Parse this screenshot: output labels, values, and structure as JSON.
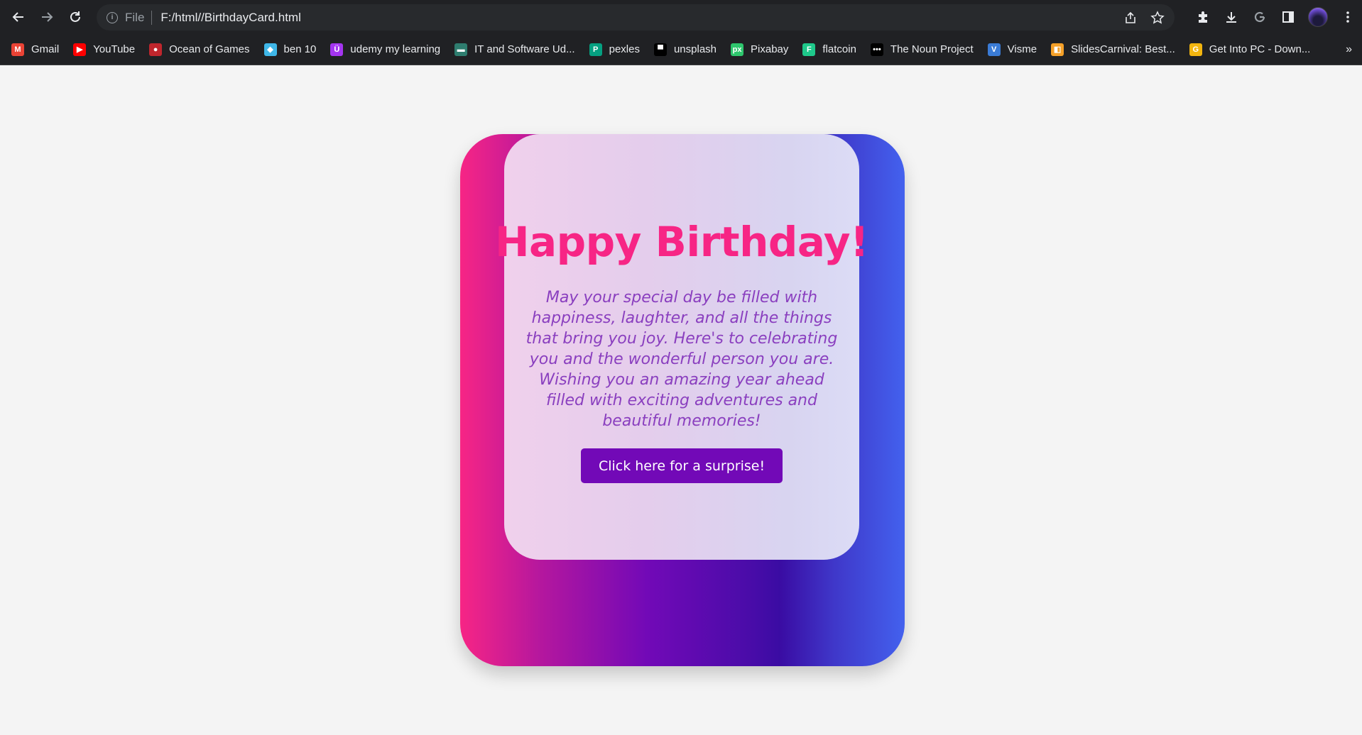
{
  "browser": {
    "file_label": "File",
    "url": "F:/html//BirthdayCard.html",
    "bookmarks": [
      {
        "label": "Gmail",
        "icon": "gmail-icon",
        "color": "#ea4335"
      },
      {
        "label": "YouTube",
        "icon": "youtube-icon",
        "color": "#ff0000"
      },
      {
        "label": "Ocean of Games",
        "icon": "gamepad-icon",
        "color": "#c0262d"
      },
      {
        "label": "ben 10",
        "icon": "ben10-icon",
        "color": "#3fb7e8"
      },
      {
        "label": "udemy my learning",
        "icon": "udemy-icon",
        "color": "#a435f0"
      },
      {
        "label": "IT and Software Ud...",
        "icon": "it-software-icon",
        "color": "#2e7d6f"
      },
      {
        "label": "pexles",
        "icon": "pexels-icon",
        "color": "#05a081"
      },
      {
        "label": "unsplash",
        "icon": "unsplash-icon",
        "color": "#000000"
      },
      {
        "label": "Pixabay",
        "icon": "pixabay-icon",
        "color": "#2ec66d"
      },
      {
        "label": "flatcoin",
        "icon": "flaticon-icon",
        "color": "#1ec88a"
      },
      {
        "label": "The Noun Project",
        "icon": "noun-project-icon",
        "color": "#000000"
      },
      {
        "label": "Visme",
        "icon": "visme-icon",
        "color": "#3a7bd5"
      },
      {
        "label": "SlidesCarnival: Best...",
        "icon": "slidescarnival-icon",
        "color": "#f4a028"
      },
      {
        "label": "Get Into PC - Down...",
        "icon": "getintopc-icon",
        "color": "#f2b50f"
      }
    ],
    "more_label": "»"
  },
  "card": {
    "title": "Happy Birthday!",
    "message": "May your special day be filled with happiness, laughter, and all the things that bring you joy. Here's to celebrating you and the wonderful person you are. Wishing you an amazing year ahead filled with exciting adventures and beautiful memories!",
    "button_label": "Click here for a surprise!"
  },
  "colors": {
    "title": "#f72585",
    "message": "#8a3fbf",
    "button": "#7209b7",
    "page_bg": "#f4f4f4"
  }
}
